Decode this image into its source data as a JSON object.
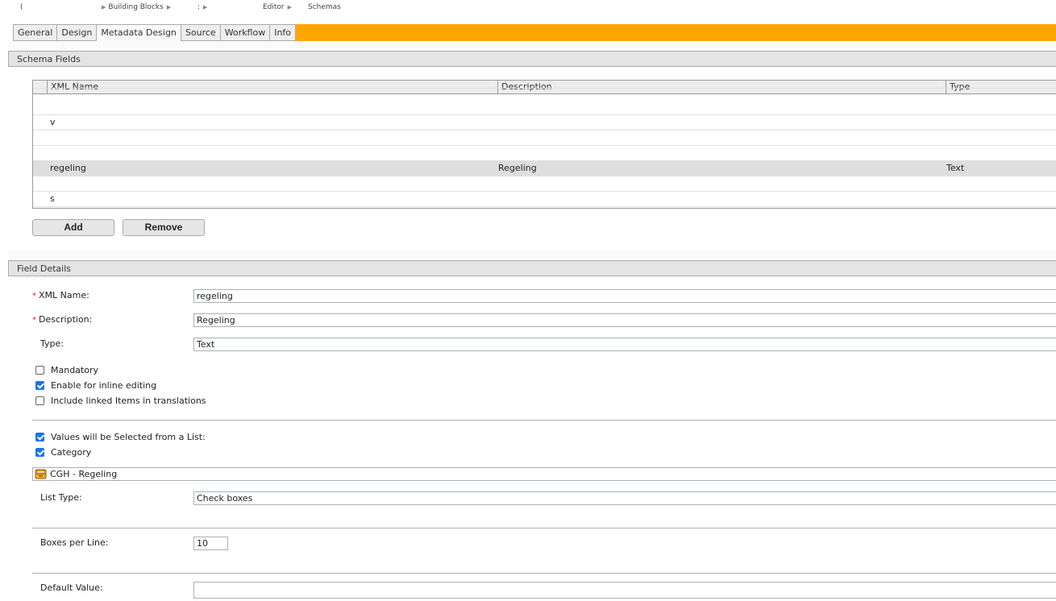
{
  "breadcrumb": [
    {
      "label": "(",
      "redacted": true
    },
    {
      "label": "Building Blocks"
    },
    {
      "label": ":",
      "redacted": true
    },
    {
      "label": "Editor"
    },
    {
      "label": "Schemas"
    }
  ],
  "tabs": [
    {
      "label": "General",
      "active": false
    },
    {
      "label": "Design",
      "active": false
    },
    {
      "label": "Metadata Design",
      "active": true
    },
    {
      "label": "Source",
      "active": false
    },
    {
      "label": "Workflow",
      "active": false
    },
    {
      "label": "Info",
      "active": false
    }
  ],
  "colors": {
    "accent": "#ffa500",
    "checkbox": "#1a73e8",
    "required": "#d9262b"
  },
  "schema_fields": {
    "title": "Schema Fields",
    "columns": [
      "XML Name",
      "Description",
      "Type"
    ],
    "rows": [
      {
        "xml_name": "",
        "description": "",
        "type": ""
      },
      {
        "xml_name": "",
        "description": "",
        "type": ""
      },
      {
        "xml_name": "v",
        "description": "",
        "type": ""
      },
      {
        "xml_name": "",
        "description": "",
        "type": ""
      },
      {
        "xml_name": "",
        "description": "",
        "type": ""
      },
      {
        "xml_name": "regeling",
        "description": "Regeling",
        "type": "Text",
        "selected": true
      },
      {
        "xml_name": "",
        "description": "",
        "type": ""
      },
      {
        "xml_name": "s",
        "description": "",
        "type": ""
      }
    ],
    "add_label": "Add",
    "remove_label": "Remove"
  },
  "field_details": {
    "title": "Field Details",
    "xml_name_label": "XML Name:",
    "xml_name_value": "regeling",
    "description_label": "Description:",
    "description_value": "Regeling",
    "type_label": "Type:",
    "type_value": "Text",
    "required_marker": "*",
    "checkboxes": [
      {
        "label": "Mandatory",
        "checked": false
      },
      {
        "label": "Enable for inline editing",
        "checked": true
      },
      {
        "label": "Include linked Items in translations",
        "checked": false
      }
    ],
    "list_checkboxes": [
      {
        "label": "Values will be Selected from a List:",
        "checked": true
      },
      {
        "label": "Category",
        "checked": true
      }
    ],
    "category_name": "CGH - Regeling",
    "category_icon": "category-folder-icon",
    "list_type_label": "List Type:",
    "list_type_value": "Check boxes",
    "boxes_per_line_label": "Boxes per Line:",
    "boxes_per_line_value": "10",
    "default_value_label": "Default Value:",
    "default_value_value": ""
  }
}
